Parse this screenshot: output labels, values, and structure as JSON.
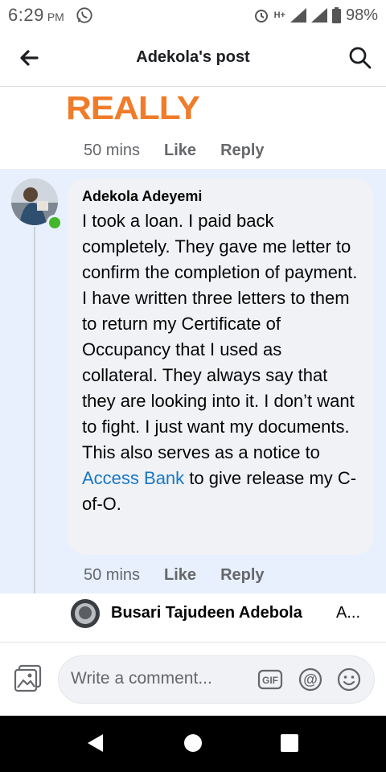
{
  "status_bar": {
    "time": "6:29",
    "ampm": "PM",
    "network": "H+",
    "battery": "98%"
  },
  "header": {
    "title": "Adekola's post"
  },
  "previous_reply": {
    "sticker_text": "REALLY",
    "time": "50 mins",
    "like_label": "Like",
    "reply_label": "Reply"
  },
  "comment": {
    "author": "Adekola Adeyemi",
    "text_before_link": "I took a loan. I paid back completely. They gave me letter to confirm the completion of payment. I have written three letters to them to return my Certificate of Occupancy that I used as collateral. They always say that they are looking into it. I don’t want to fight. I just want my documents.\nThis also serves as a notice to ",
    "link_text": "Access Bank",
    "text_after_link": " to give release my C-of-O.",
    "time": "50 mins",
    "like_label": "Like",
    "reply_label": "Reply"
  },
  "reply_preview": {
    "name": "Busari Tajudeen Adebola",
    "snippet": "A..."
  },
  "composer": {
    "placeholder": "Write a comment..."
  },
  "colors": {
    "highlight_bg": "#e7f0fc",
    "link": "#1877c5",
    "online": "#42b72a",
    "sticker": "#f07c2a"
  }
}
